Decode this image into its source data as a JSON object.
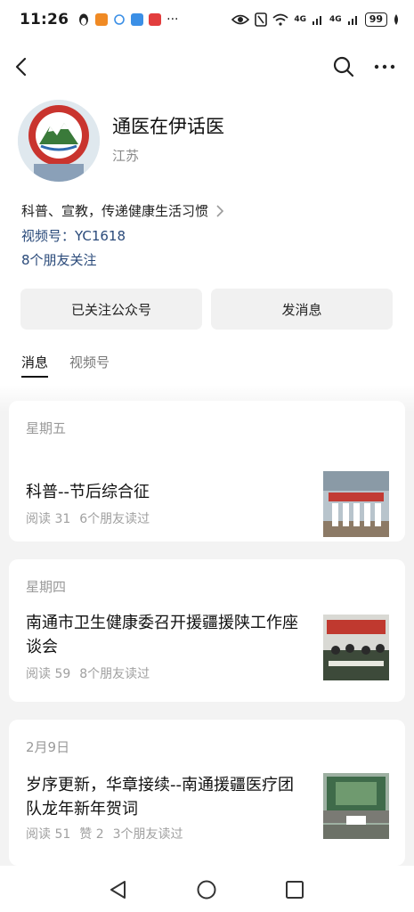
{
  "status_bar": {
    "time": "11:26",
    "battery": "99",
    "signal_1": "4G",
    "signal_2": "4G",
    "colors": {
      "app1": "#f7b500",
      "app2": "#f08a24",
      "app3": "#3b8fe6",
      "app4": "#e23d3d"
    }
  },
  "nav": {
    "back_icon": "back-arrow-icon",
    "search_icon": "search-icon",
    "more_icon": "more-dots-icon"
  },
  "profile": {
    "name": "通医在伊话医",
    "region": "江苏",
    "description": "科普、宣教，传递健康生活习惯",
    "channel": "视频号：YC1618",
    "friends_follow": "8个朋友关注"
  },
  "actions": {
    "followed_label": "已关注公众号",
    "message_label": "发消息"
  },
  "tabs": {
    "messages": "消息",
    "channel": "视频号"
  },
  "feed": [
    {
      "day": "星期五",
      "title": "科普--节后综合征",
      "reads": "阅读 31",
      "friends_read": "6个朋友读过"
    },
    {
      "day": "星期四",
      "title": "南通市卫生健康委召开援疆援陕工作座谈会",
      "reads": "阅读 59",
      "friends_read": "8个朋友读过"
    },
    {
      "day": "2月9日",
      "title": "岁序更新，华章接续--南通援疆医疗团队龙年新年贺词",
      "reads": "阅读 51",
      "likes": "赞 2",
      "friends_read": "3个朋友读过"
    }
  ]
}
